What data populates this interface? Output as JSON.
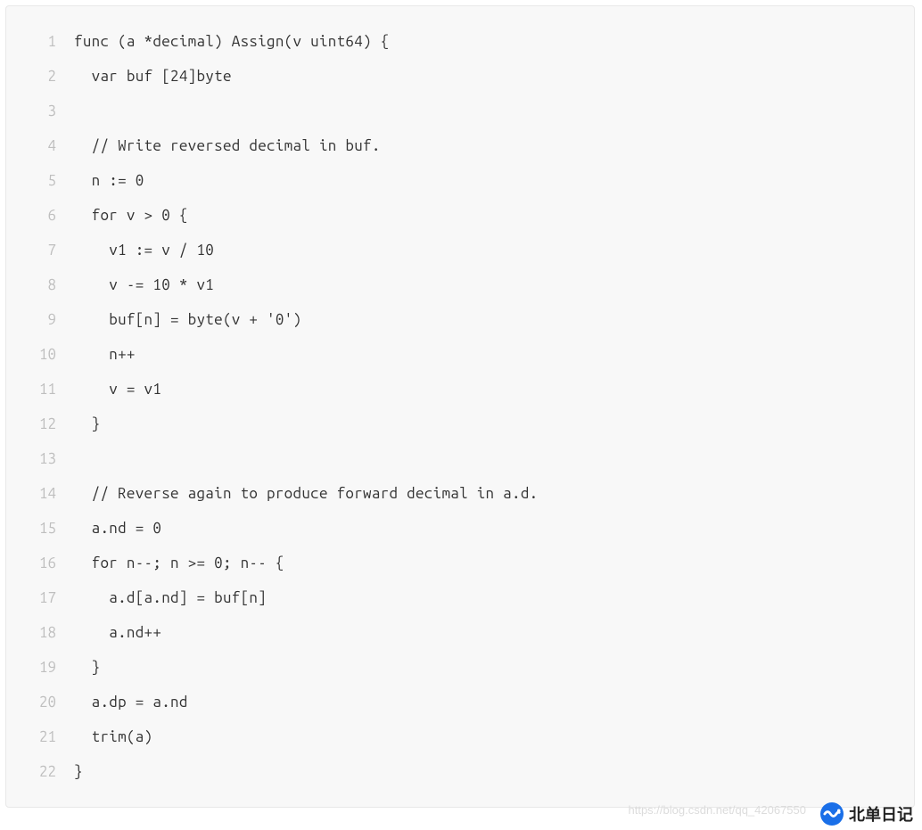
{
  "code": {
    "lines": [
      "func (a *decimal) Assign(v uint64) {",
      "  var buf [24]byte",
      "",
      "  // Write reversed decimal in buf.",
      "  n := 0",
      "  for v > 0 {",
      "    v1 := v / 10",
      "    v -= 10 * v1",
      "    buf[n] = byte(v + '0')",
      "    n++",
      "    v = v1",
      "  }",
      "",
      "  // Reverse again to produce forward decimal in a.d.",
      "  a.nd = 0",
      "  for n--; n >= 0; n-- {",
      "    a.d[a.nd] = buf[n]",
      "    a.nd++",
      "  }",
      "  a.dp = a.nd",
      "  trim(a)",
      "}"
    ]
  },
  "watermark": "https://blog.csdn.net/qq_42067550",
  "brand": "北单日记"
}
